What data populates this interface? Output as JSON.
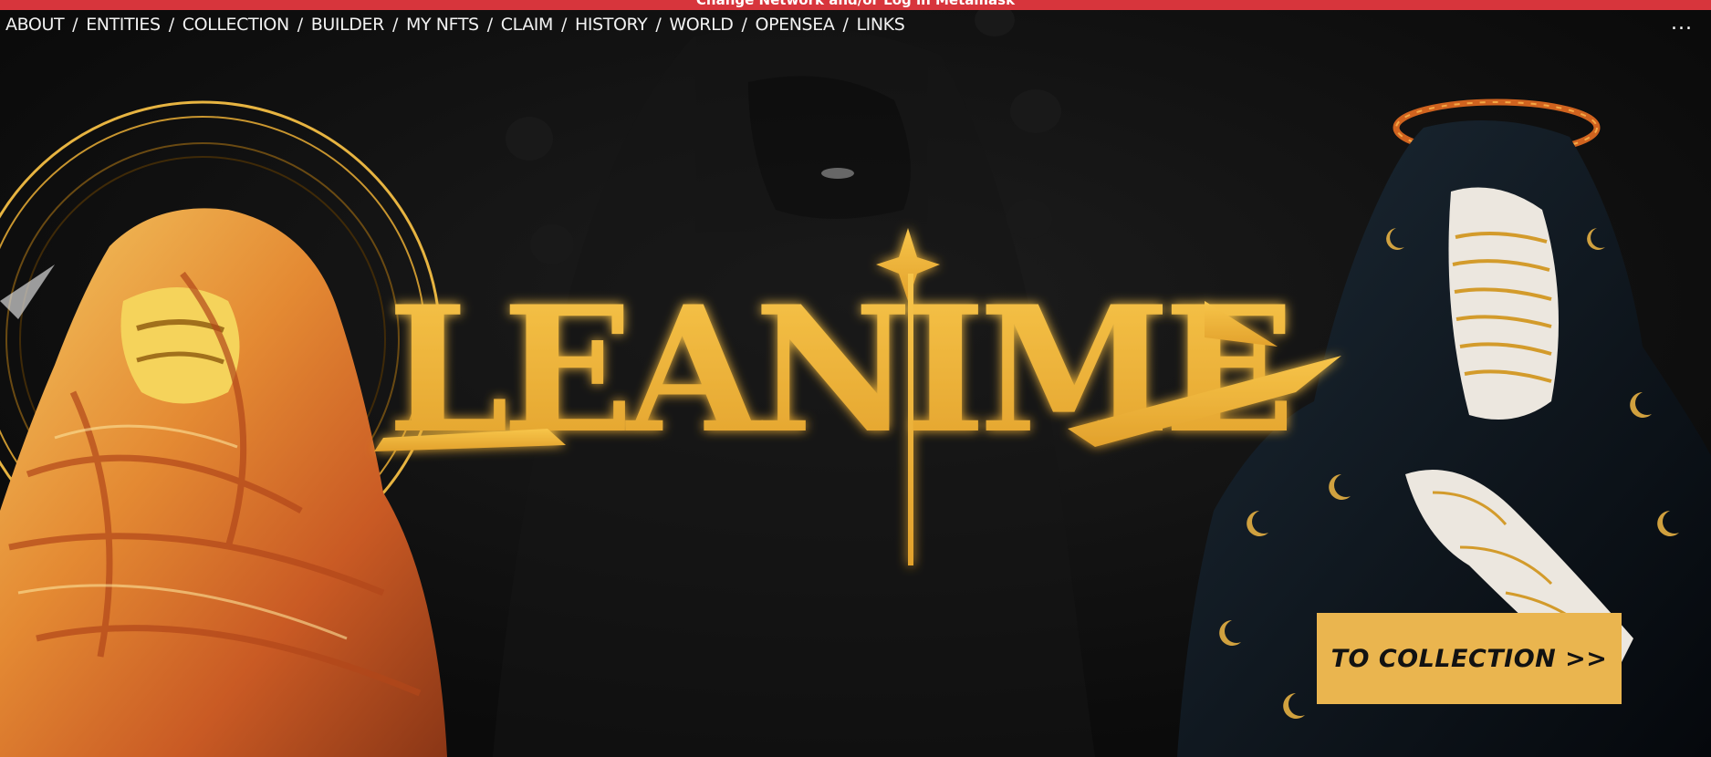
{
  "alert": {
    "text": "Change Network and/or Log in Metamask"
  },
  "nav": {
    "items": [
      "ABOUT",
      "ENTITIES",
      "COLLECTION",
      "BUILDER",
      "MY NFTS",
      "CLAIM",
      "HISTORY",
      "WORLD",
      "OPENSEA",
      "LINKS"
    ],
    "separator": "/",
    "more_label": "..."
  },
  "hero": {
    "logo_text": "LEANIME",
    "cta_label": "TO COLLECTION >>"
  },
  "colors": {
    "accent_gold": "#eab54f",
    "alert_red": "#d7353c",
    "background": "#0b0b0b"
  }
}
